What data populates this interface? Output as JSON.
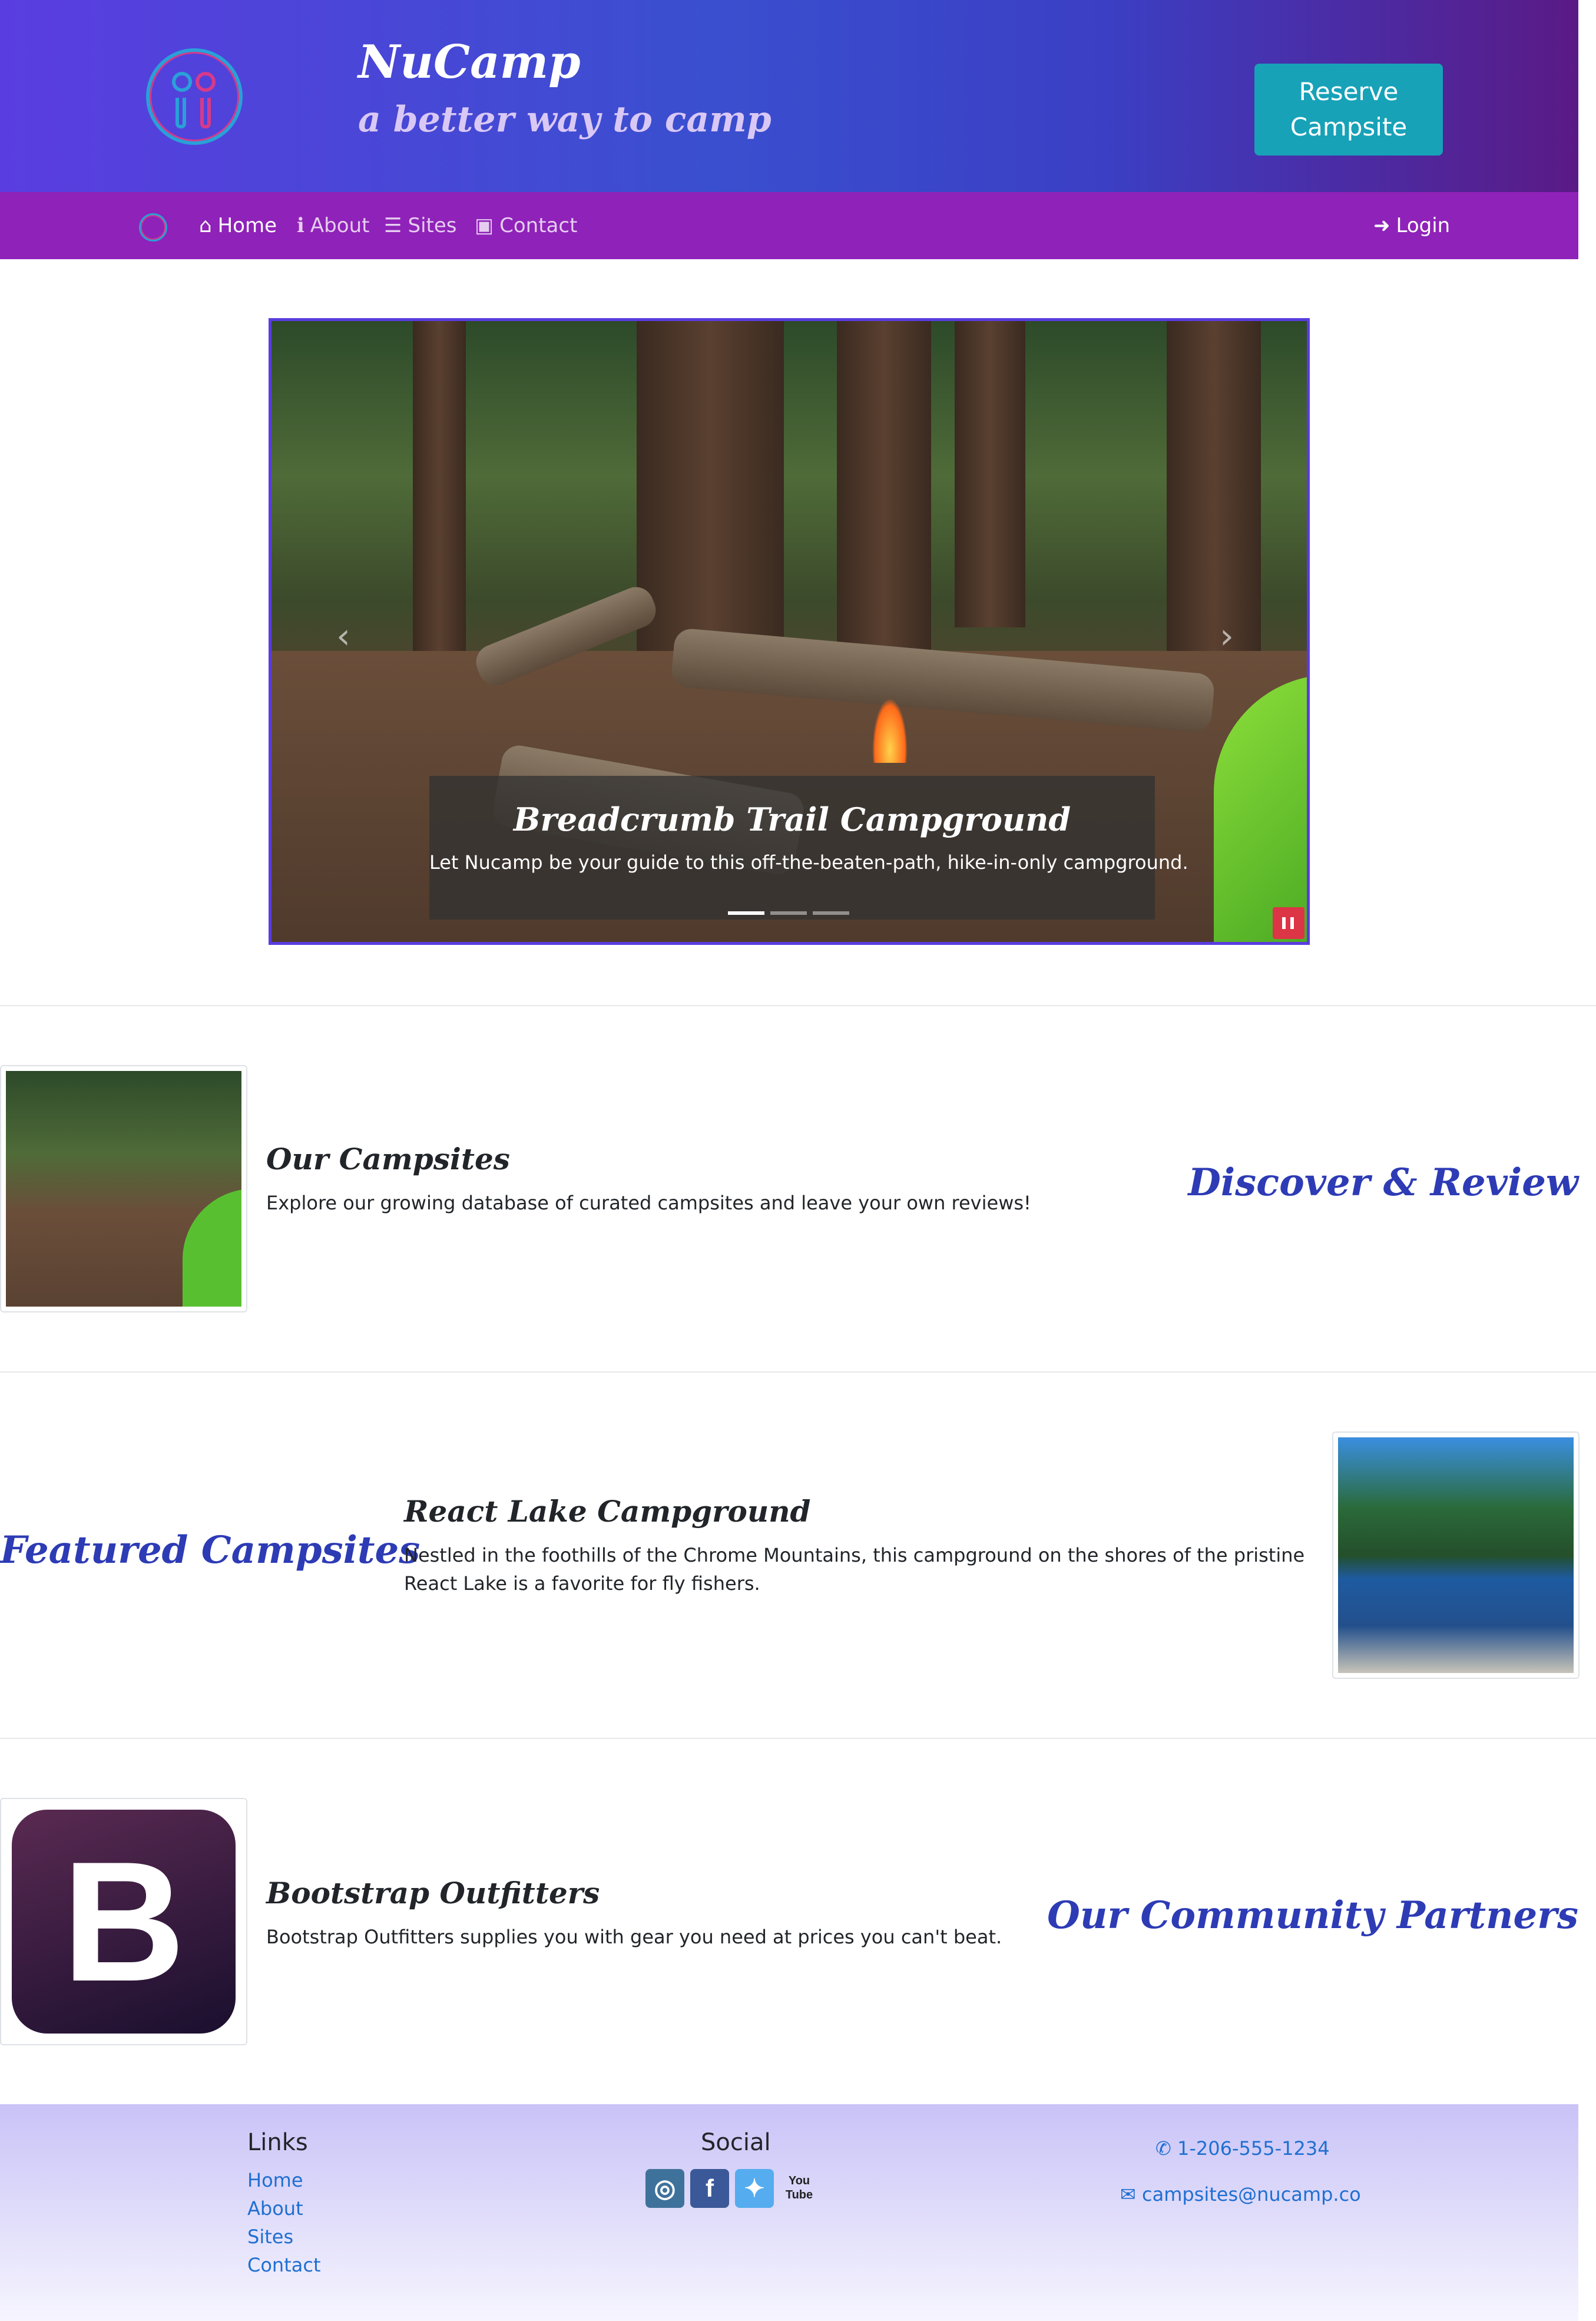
{
  "header": {
    "title": "NuCamp",
    "tagline": "a better way to camp",
    "reserve_label_line1": "Reserve",
    "reserve_label_line2": "Campsite"
  },
  "nav": {
    "items": [
      {
        "label": "Home",
        "icon": "home-icon"
      },
      {
        "label": "About",
        "icon": "info-icon"
      },
      {
        "label": "Sites",
        "icon": "list-icon"
      },
      {
        "label": "Contact",
        "icon": "address-card-icon"
      }
    ],
    "login_label": "Login"
  },
  "carousel": {
    "caption_title": "Breadcrumb Trail Campground",
    "caption_text": "Let Nucamp be your guide to this off-the-beaten-path, hike-in-only campground.",
    "slide_count": 3,
    "active_slide": 0
  },
  "sections": [
    {
      "heading": "Discover & Review",
      "title": "Our Campsites",
      "text": "Explore our growing database of curated campsites and leave your own reviews!"
    },
    {
      "heading": "Featured Campsites",
      "title": "React Lake Campground",
      "text": "Nestled in the foothills of the Chrome Mountains, this campground on the shores of the pristine React Lake is a favorite for fly fishers."
    },
    {
      "heading": "Our Community Partners",
      "title": "Bootstrap Outfitters",
      "text": "Bootstrap Outfitters supplies you with gear you need at prices you can't beat.",
      "logo_letter": "B"
    }
  ],
  "footer": {
    "links_heading": "Links",
    "links": [
      "Home",
      "About",
      "Sites",
      "Contact"
    ],
    "social_heading": "Social",
    "social": [
      {
        "icon": "instagram-icon",
        "color": "#3f729b"
      },
      {
        "icon": "facebook-icon",
        "color": "#3b5998"
      },
      {
        "icon": "twitter-icon",
        "color": "#55acee"
      },
      {
        "icon": "youtube-icon",
        "color": "#222222",
        "text": "You Tube"
      }
    ],
    "phone": "1-206-555-1234",
    "email": "campsites@nucamp.co"
  },
  "colors": {
    "accent": "#2d3bb5",
    "navbar": "#8f22b8",
    "reserve_button": "#17a2b8",
    "pause_button": "#dc3545",
    "link": "#1f6fd1"
  }
}
